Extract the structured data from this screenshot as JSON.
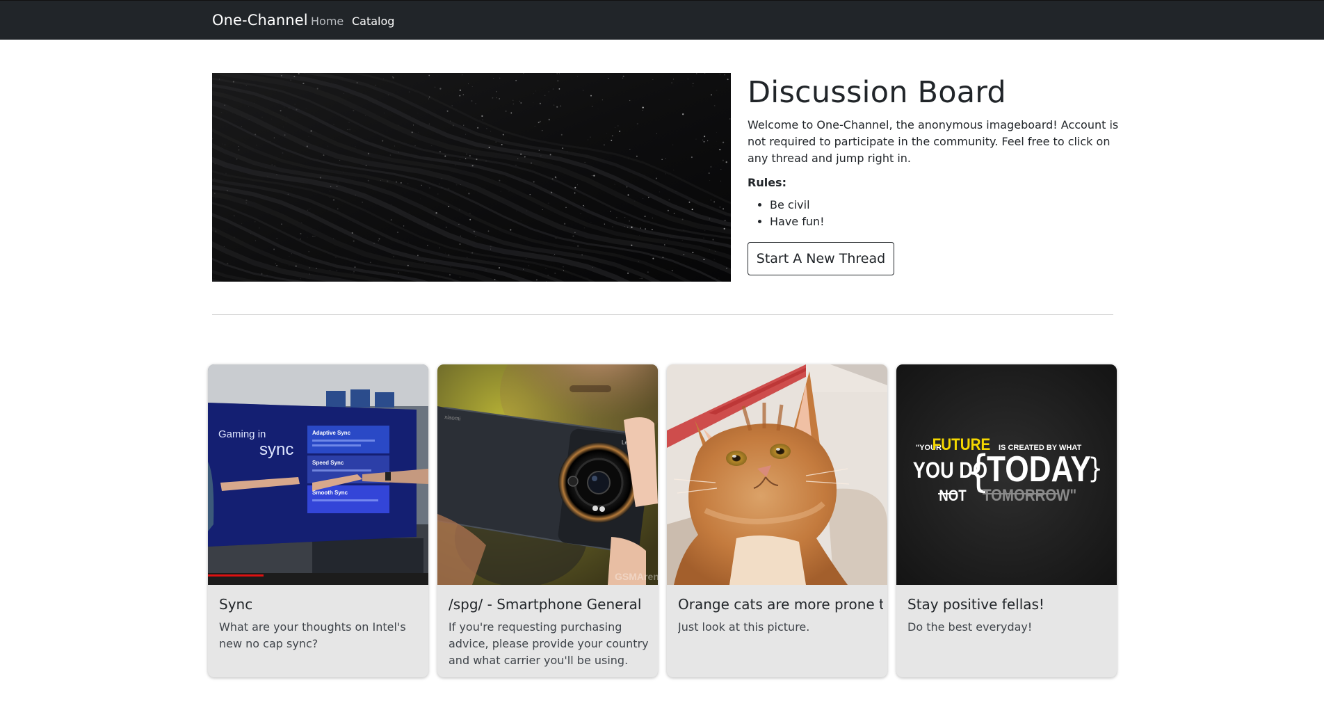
{
  "nav": {
    "brand": "One-Channel",
    "links": [
      {
        "label": "Home"
      },
      {
        "label": "Catalog"
      }
    ]
  },
  "hero": {
    "title": "Discussion Board",
    "intro": "Welcome to One-Channel, the anonymous imageboard! Account is not required to participate in the community. Feel free to click on any thread and jump right in.",
    "rules_label": "Rules:",
    "rules": [
      "Be civil",
      "Have fun!"
    ],
    "button_label": "Start A New Thread"
  },
  "threads": [
    {
      "title": "Sync",
      "text": "What are your thoughts on Intel's new no cap sync?",
      "image": "presentation-screen-photo",
      "image_text": {
        "heading_small": "Gaming in",
        "heading_large": "sync",
        "panels": [
          "Adaptive Sync",
          "Speed Sync",
          "Smooth Sync"
        ]
      }
    },
    {
      "title": "/spg/ - Smartphone General",
      "text": "If you're requesting purchasing advice, please provide your country and what carrier you'll be using. Include the…",
      "image": "camera-phone-photo",
      "image_text": {
        "brand": "xiaomi",
        "lens_brand": "Leica",
        "watermark": "GSMArena"
      }
    },
    {
      "title": "Orange cats are more prone to",
      "text": "Just look at this picture.",
      "image": "orange-cat-photo"
    },
    {
      "title": "Stay positive fellas!",
      "text": "Do the best everyday!",
      "image": "motivational-quote-image",
      "image_text": {
        "line1_a": "\"YOUR",
        "line1_b": "FUTURE",
        "line1_c": "IS CREATED BY WHAT",
        "you_do": "YOU DO",
        "not": "NOT",
        "today": "TODAY",
        "tomorrow": "TOMORROW\""
      }
    }
  ],
  "colors": {
    "navbar_bg": "#212529",
    "card_bg": "#e6e6e6",
    "quote_accent": "#f5d800"
  }
}
